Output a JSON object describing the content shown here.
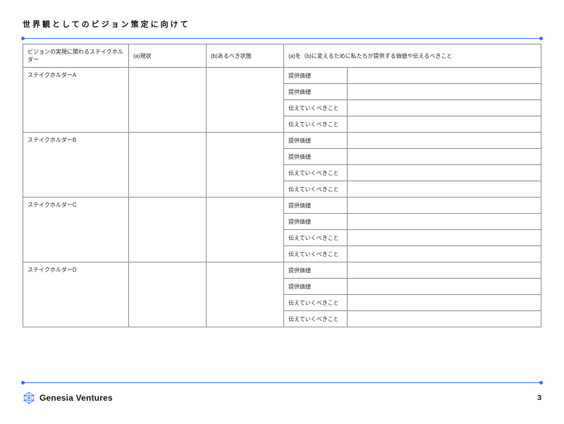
{
  "title": "世界観としてのビジョン策定に向けて",
  "headers": {
    "col1": "ビジョンの実現に関わるステイクホルダー",
    "col2": "(a)現状",
    "col3": "(b)あるべき状態",
    "col4": "(a)を（b)に変えるために私たちが提供する価値や伝えるべきこと"
  },
  "rowLabels": {
    "value": "提供価値",
    "message": "伝えていくべきこと"
  },
  "stakeholders": [
    {
      "name": "ステイクホルダーA"
    },
    {
      "name": "ステイクホルダーB"
    },
    {
      "name": "ステイクホルダーC"
    },
    {
      "name": "ステイクホルダーD"
    }
  ],
  "footer": {
    "company": "Genesia Ventures",
    "pageNumber": "3"
  }
}
